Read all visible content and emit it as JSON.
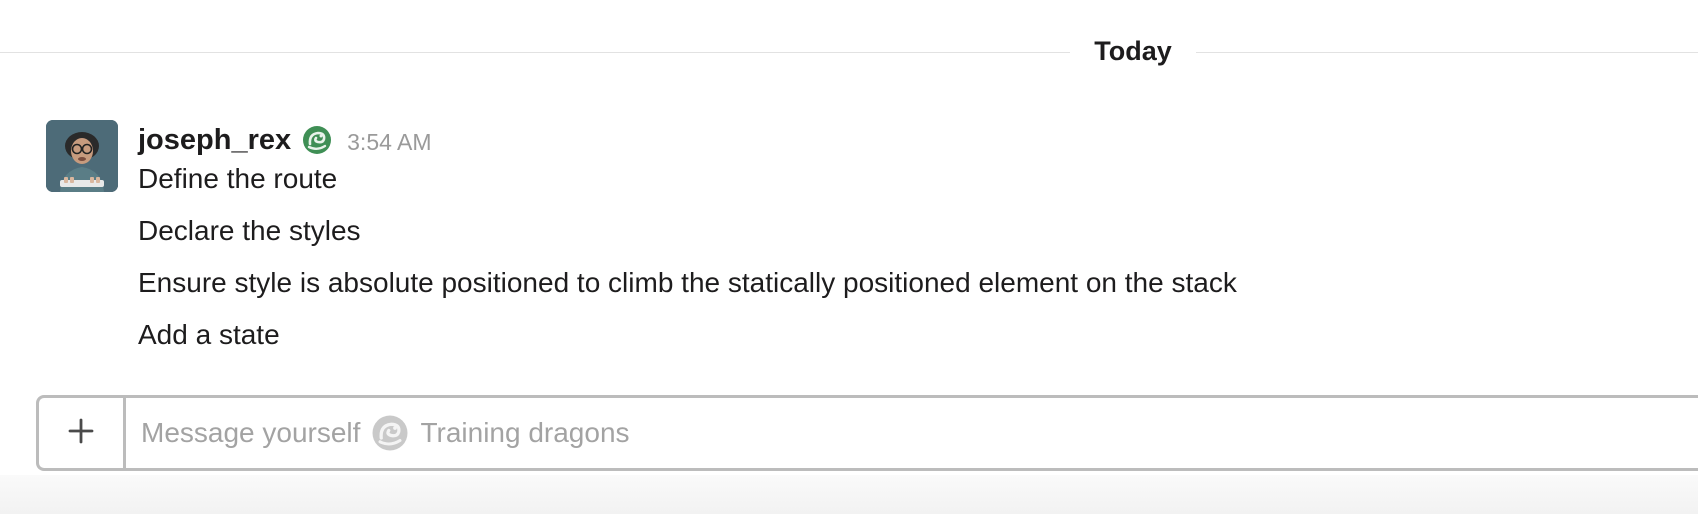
{
  "day_divider": {
    "label": "Today"
  },
  "message": {
    "username": "joseph_rex",
    "status_emoji": "dragon-icon",
    "timestamp": "3:54 AM",
    "lines": [
      "Define the route",
      "Declare the styles",
      "Ensure style is absolute positioned to climb the statically positioned element on the stack",
      "Add a state"
    ]
  },
  "composer": {
    "attach_icon": "plus-icon",
    "placeholder_prefix": "Message yourself",
    "placeholder_status_icon": "dragon-icon",
    "placeholder_suffix": "Training dragons"
  },
  "colors": {
    "text": "#1d1c1d",
    "muted": "#9a9a9a",
    "border": "#bcbcbc",
    "divider": "#e2e2e2",
    "dragon_green": "#3f8f55"
  }
}
